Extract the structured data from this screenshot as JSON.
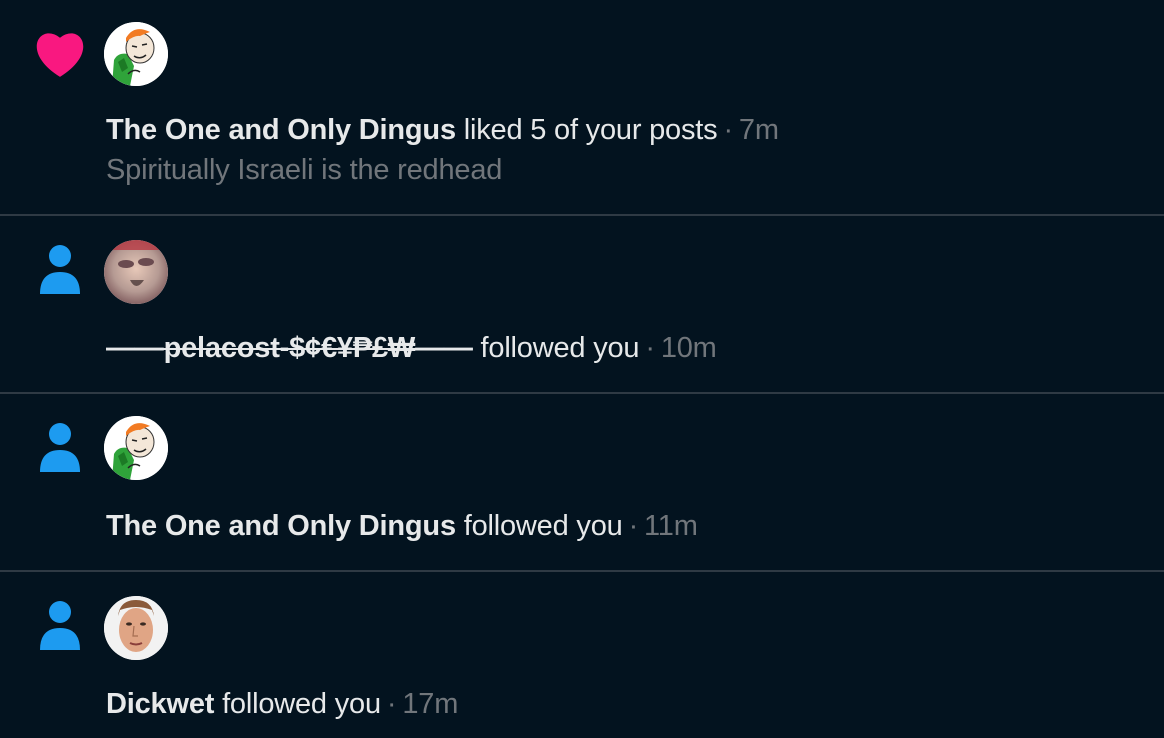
{
  "colors": {
    "background": "#03131f",
    "heart": "#f91880",
    "follow_icon": "#1d9bf0",
    "muted_text": "#71767b",
    "primary_text": "#e7e9ea",
    "divider": "#2f3a44"
  },
  "notifications": [
    {
      "type": "like",
      "type_icon": "heart-icon",
      "avatar": "cartoon-redhead-avatar",
      "name": "The One and Only Dingus",
      "action": "liked 5 of your posts",
      "separator": "·",
      "time": "7m",
      "preview": "Spiritually Israeli is the redhead"
    },
    {
      "type": "follow",
      "type_icon": "person-icon",
      "avatar": "blurry-face-avatar",
      "name": "——pelacost-$¢€¥₱£₩——",
      "action": "followed you",
      "separator": "·",
      "time": "10m"
    },
    {
      "type": "follow",
      "type_icon": "person-icon",
      "avatar": "cartoon-redhead-avatar",
      "name": "The One and Only Dingus",
      "action": "followed you",
      "separator": "·",
      "time": "11m"
    },
    {
      "type": "follow",
      "type_icon": "person-icon",
      "avatar": "man-face-avatar",
      "name": "Dickwet",
      "action": "followed you",
      "separator": "·",
      "time": "17m"
    }
  ]
}
